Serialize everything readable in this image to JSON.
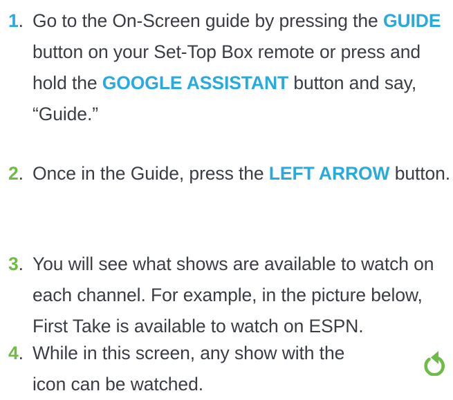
{
  "steps": [
    {
      "number": "1",
      "dot": ".",
      "text_a": " Go to the On-Screen guide by pressing the ",
      "hl_a": "GUIDE",
      "text_b": " button on your Set-Top Box remote or press and hold the ",
      "hl_b": "GOOGLE ASSISTANT",
      "text_c": " button and say, “Guide.”"
    },
    {
      "number": "2",
      "dot": ".",
      "text_a": " Once in the Guide, press the ",
      "hl_a": "LEFT ARROW",
      "text_b": " button."
    },
    {
      "number": "3",
      "dot": ".",
      "text_a": " You will see what shows are available to watch on each channel. For example, in the picture below, First Take is available to watch on ESPN."
    },
    {
      "number": "4",
      "dot": ".",
      "text_a": " While in this screen, any show with the ",
      "text_b": "icon can be watched.",
      "icon": "replay-icon"
    }
  ],
  "colors": {
    "body_text": "#3a3d44",
    "highlight": "#29aadf",
    "step_number_1": "#29aadf",
    "step_number_green": "#6cbc45",
    "icon": "#6cbc45"
  }
}
